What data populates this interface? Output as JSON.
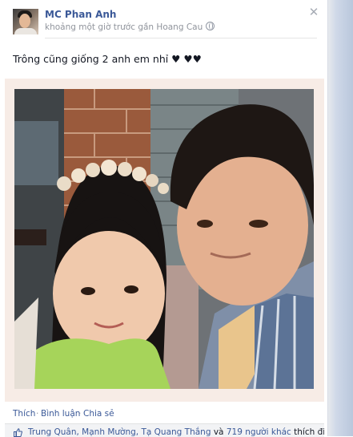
{
  "post": {
    "author": "MC Phan Anh",
    "meta": "khoảng một giờ trước gần Hoang Cau",
    "privacy_icon": "globe-icon",
    "close_icon": "close-icon",
    "text": "Trông cũng giống 2 anh em nhỉ ♥ ♥♥"
  },
  "actions": {
    "like": "Thích",
    "comment": "Bình luận",
    "share": "Chia sẻ",
    "separator": "·"
  },
  "likes": {
    "names": "Trung Quân, Mạnh Mường, Tạ Quang Thắng",
    "conjunction": "và",
    "others": "719 người khác",
    "suffix": "thích điều"
  },
  "colors": {
    "link": "#3b5998",
    "meta_text": "#90949c",
    "photo_frame": "#f7ece6"
  }
}
